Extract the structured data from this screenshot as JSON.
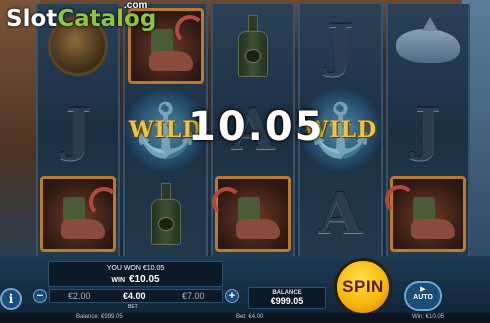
{
  "logo": {
    "brand_part1": "Slot",
    "brand_part2": "Catalog",
    "tld": ".com"
  },
  "win_display": "10.05",
  "reels": [
    [
      "helmet",
      "J",
      "boot"
    ],
    [
      "boot",
      "wild",
      "bottle"
    ],
    [
      "bottle",
      "A",
      "boot"
    ],
    [
      "J",
      "wild",
      "A"
    ],
    [
      "shark",
      "J",
      "boot"
    ]
  ],
  "wild_text": "WILD",
  "message": {
    "line1": "YOU WON €10.05",
    "win_label": "WIN",
    "win_value": "€10.05"
  },
  "bet": {
    "options": [
      "€2.00",
      "€4.00",
      "€7.00"
    ],
    "selected_index": 1,
    "label": "BET",
    "minus": "−",
    "plus": "+"
  },
  "info_button": "i",
  "balance": {
    "title": "BALANCE",
    "value": "€999.05"
  },
  "spin_label": "SPIN",
  "auto": {
    "icon": "▶",
    "label": "AUTO"
  },
  "status_bar": {
    "balance": "Balance: €999.05",
    "bet": "Bet: €4.00",
    "win": "Win: €10.05"
  },
  "colors": {
    "spin": "#f5b40a",
    "accent_green": "#8dc63f",
    "frame": "#b97a2a"
  }
}
